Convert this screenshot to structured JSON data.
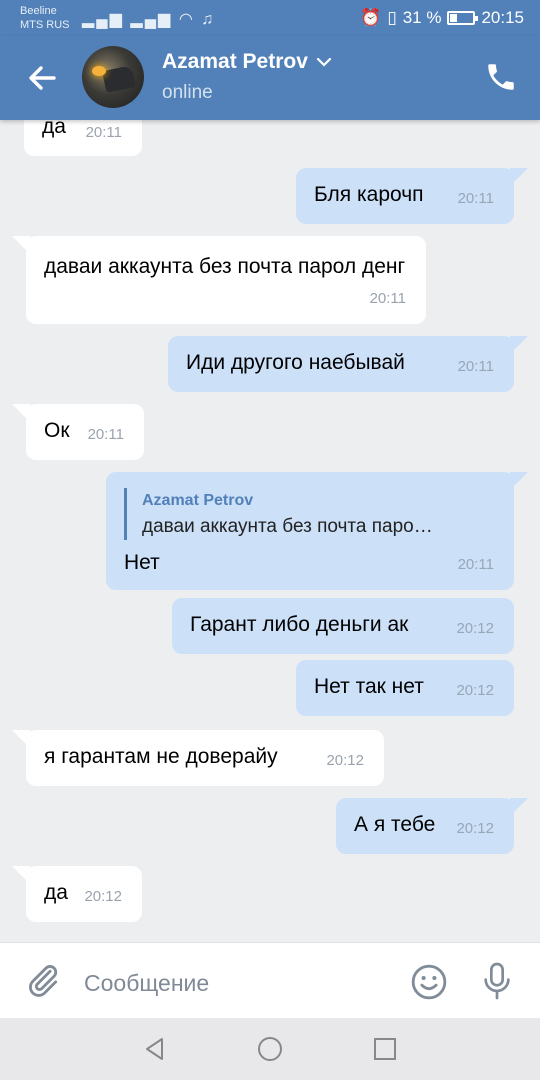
{
  "statusbar": {
    "carrier1": "Beeline",
    "carrier2": "MTS RUS",
    "battery_percent": "31 %",
    "time": "20:15"
  },
  "header": {
    "name": "Azamat Petrov",
    "status": "online"
  },
  "messages": [
    {
      "dir": "in",
      "text": "да",
      "time": "20:11"
    },
    {
      "dir": "out",
      "text": "Бля карочп",
      "time": "20:11"
    },
    {
      "dir": "in",
      "text": "даваи аккаунта без почта парол денг",
      "time": "20:11"
    },
    {
      "dir": "out",
      "text": "Иди другого наебывай",
      "time": "20:11"
    },
    {
      "dir": "in",
      "text": "Ок",
      "time": "20:11"
    },
    {
      "dir": "out",
      "reply_name": "Azamat Petrov",
      "reply_text": "даваи аккаунта без почта паро…",
      "text": "Нет",
      "time": "20:11"
    },
    {
      "dir": "out",
      "text": "Гарант либо деньги ак",
      "time": "20:12"
    },
    {
      "dir": "out",
      "text": "Нет так нет",
      "time": "20:12"
    },
    {
      "dir": "in",
      "text": "я гарантам не доверайу",
      "time": "20:12"
    },
    {
      "dir": "out",
      "text": "А я тебе",
      "time": "20:12"
    },
    {
      "dir": "in",
      "text": "да",
      "time": "20:12"
    }
  ],
  "composer": {
    "placeholder": "Сообщение"
  },
  "colors": {
    "header": "#5181b8",
    "incoming_bubble": "#ffffff",
    "outgoing_bubble": "#cce0f8",
    "background": "#edeef0"
  }
}
